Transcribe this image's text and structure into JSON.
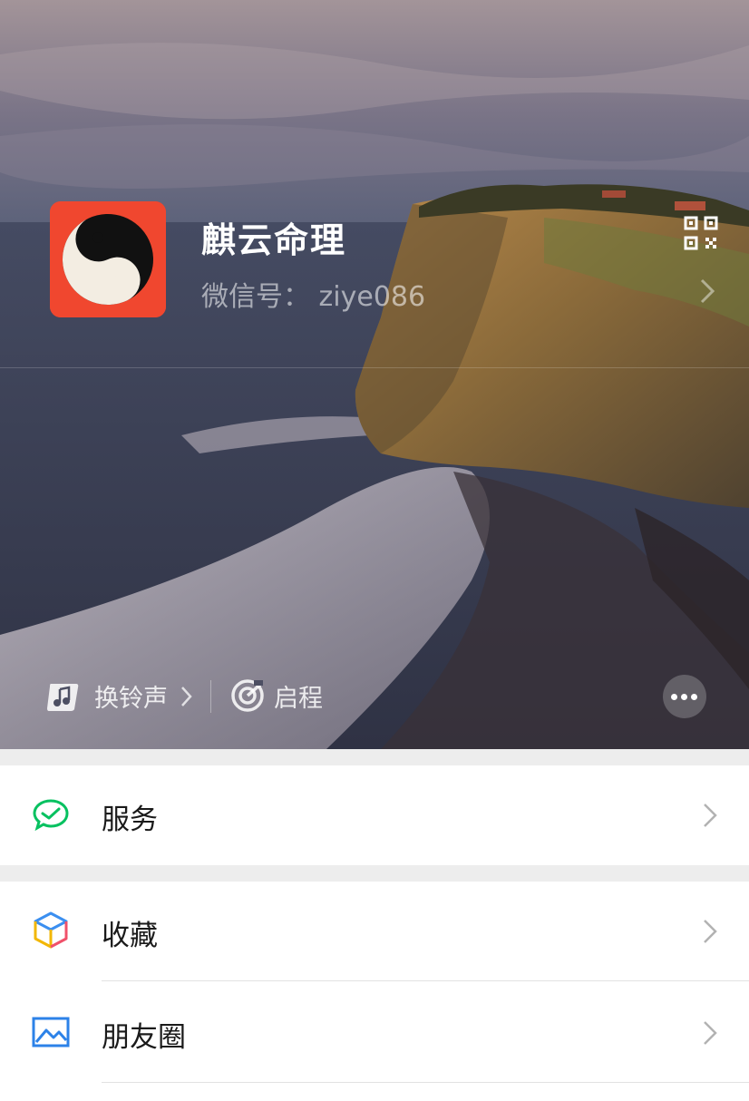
{
  "profile": {
    "name": "麒云命理",
    "wechat_id": "微信号： ziye086"
  },
  "cover_bar": {
    "ringtone_label": "换铃声",
    "status_label": "启程"
  },
  "menu": {
    "items": [
      {
        "label": "服务",
        "icon": "chat-check-icon"
      },
      {
        "label": "收藏",
        "icon": "cube-icon"
      },
      {
        "label": "朋友圈",
        "icon": "picture-icon"
      }
    ]
  },
  "colors": {
    "avatar_bg": "#f0472f",
    "service_green": "#07c160",
    "page_gray": "#ededed"
  }
}
